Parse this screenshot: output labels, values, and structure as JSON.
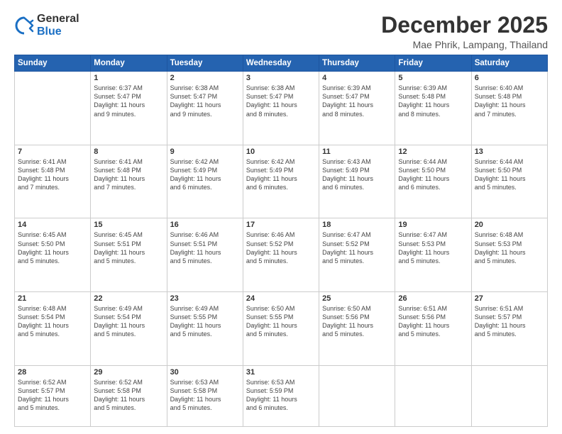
{
  "logo": {
    "general": "General",
    "blue": "Blue"
  },
  "header": {
    "month": "December 2025",
    "location": "Mae Phrik, Lampang, Thailand"
  },
  "weekdays": [
    "Sunday",
    "Monday",
    "Tuesday",
    "Wednesday",
    "Thursday",
    "Friday",
    "Saturday"
  ],
  "weeks": [
    [
      {
        "day": "",
        "info": ""
      },
      {
        "day": "1",
        "info": "Sunrise: 6:37 AM\nSunset: 5:47 PM\nDaylight: 11 hours\nand 9 minutes."
      },
      {
        "day": "2",
        "info": "Sunrise: 6:38 AM\nSunset: 5:47 PM\nDaylight: 11 hours\nand 9 minutes."
      },
      {
        "day": "3",
        "info": "Sunrise: 6:38 AM\nSunset: 5:47 PM\nDaylight: 11 hours\nand 8 minutes."
      },
      {
        "day": "4",
        "info": "Sunrise: 6:39 AM\nSunset: 5:47 PM\nDaylight: 11 hours\nand 8 minutes."
      },
      {
        "day": "5",
        "info": "Sunrise: 6:39 AM\nSunset: 5:48 PM\nDaylight: 11 hours\nand 8 minutes."
      },
      {
        "day": "6",
        "info": "Sunrise: 6:40 AM\nSunset: 5:48 PM\nDaylight: 11 hours\nand 7 minutes."
      }
    ],
    [
      {
        "day": "7",
        "info": "Sunrise: 6:41 AM\nSunset: 5:48 PM\nDaylight: 11 hours\nand 7 minutes."
      },
      {
        "day": "8",
        "info": "Sunrise: 6:41 AM\nSunset: 5:48 PM\nDaylight: 11 hours\nand 7 minutes."
      },
      {
        "day": "9",
        "info": "Sunrise: 6:42 AM\nSunset: 5:49 PM\nDaylight: 11 hours\nand 6 minutes."
      },
      {
        "day": "10",
        "info": "Sunrise: 6:42 AM\nSunset: 5:49 PM\nDaylight: 11 hours\nand 6 minutes."
      },
      {
        "day": "11",
        "info": "Sunrise: 6:43 AM\nSunset: 5:49 PM\nDaylight: 11 hours\nand 6 minutes."
      },
      {
        "day": "12",
        "info": "Sunrise: 6:44 AM\nSunset: 5:50 PM\nDaylight: 11 hours\nand 6 minutes."
      },
      {
        "day": "13",
        "info": "Sunrise: 6:44 AM\nSunset: 5:50 PM\nDaylight: 11 hours\nand 5 minutes."
      }
    ],
    [
      {
        "day": "14",
        "info": "Sunrise: 6:45 AM\nSunset: 5:50 PM\nDaylight: 11 hours\nand 5 minutes."
      },
      {
        "day": "15",
        "info": "Sunrise: 6:45 AM\nSunset: 5:51 PM\nDaylight: 11 hours\nand 5 minutes."
      },
      {
        "day": "16",
        "info": "Sunrise: 6:46 AM\nSunset: 5:51 PM\nDaylight: 11 hours\nand 5 minutes."
      },
      {
        "day": "17",
        "info": "Sunrise: 6:46 AM\nSunset: 5:52 PM\nDaylight: 11 hours\nand 5 minutes."
      },
      {
        "day": "18",
        "info": "Sunrise: 6:47 AM\nSunset: 5:52 PM\nDaylight: 11 hours\nand 5 minutes."
      },
      {
        "day": "19",
        "info": "Sunrise: 6:47 AM\nSunset: 5:53 PM\nDaylight: 11 hours\nand 5 minutes."
      },
      {
        "day": "20",
        "info": "Sunrise: 6:48 AM\nSunset: 5:53 PM\nDaylight: 11 hours\nand 5 minutes."
      }
    ],
    [
      {
        "day": "21",
        "info": "Sunrise: 6:48 AM\nSunset: 5:54 PM\nDaylight: 11 hours\nand 5 minutes."
      },
      {
        "day": "22",
        "info": "Sunrise: 6:49 AM\nSunset: 5:54 PM\nDaylight: 11 hours\nand 5 minutes."
      },
      {
        "day": "23",
        "info": "Sunrise: 6:49 AM\nSunset: 5:55 PM\nDaylight: 11 hours\nand 5 minutes."
      },
      {
        "day": "24",
        "info": "Sunrise: 6:50 AM\nSunset: 5:55 PM\nDaylight: 11 hours\nand 5 minutes."
      },
      {
        "day": "25",
        "info": "Sunrise: 6:50 AM\nSunset: 5:56 PM\nDaylight: 11 hours\nand 5 minutes."
      },
      {
        "day": "26",
        "info": "Sunrise: 6:51 AM\nSunset: 5:56 PM\nDaylight: 11 hours\nand 5 minutes."
      },
      {
        "day": "27",
        "info": "Sunrise: 6:51 AM\nSunset: 5:57 PM\nDaylight: 11 hours\nand 5 minutes."
      }
    ],
    [
      {
        "day": "28",
        "info": "Sunrise: 6:52 AM\nSunset: 5:57 PM\nDaylight: 11 hours\nand 5 minutes."
      },
      {
        "day": "29",
        "info": "Sunrise: 6:52 AM\nSunset: 5:58 PM\nDaylight: 11 hours\nand 5 minutes."
      },
      {
        "day": "30",
        "info": "Sunrise: 6:53 AM\nSunset: 5:58 PM\nDaylight: 11 hours\nand 5 minutes."
      },
      {
        "day": "31",
        "info": "Sunrise: 6:53 AM\nSunset: 5:59 PM\nDaylight: 11 hours\nand 6 minutes."
      },
      {
        "day": "",
        "info": ""
      },
      {
        "day": "",
        "info": ""
      },
      {
        "day": "",
        "info": ""
      }
    ]
  ]
}
